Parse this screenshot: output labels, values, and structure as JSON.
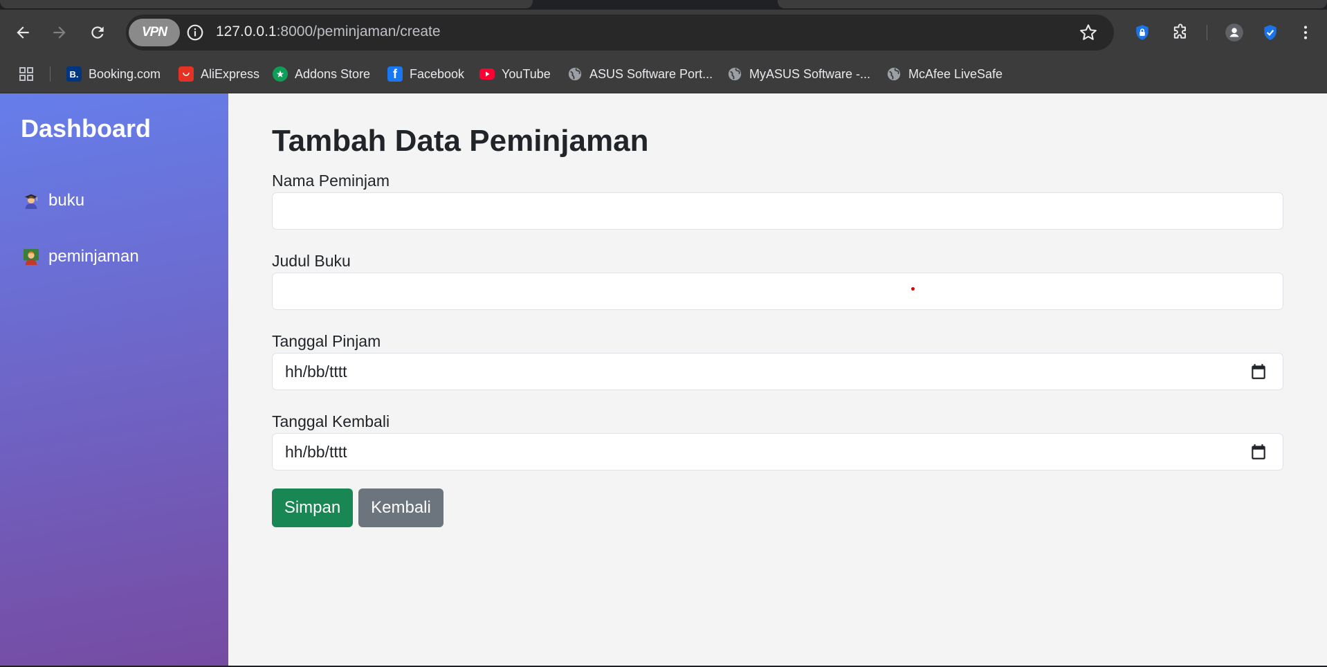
{
  "browser": {
    "url_host": "127.0.0.1",
    "url_path": ":8000/peminjaman/create",
    "vpn_label": "VPN",
    "bookmarks": [
      {
        "label": "Booking.com",
        "icon": "booking-icon",
        "color": "#003580",
        "glyph": "B."
      },
      {
        "label": "AliExpress",
        "icon": "aliexpress-icon",
        "color": "#e43225",
        "glyph": ""
      },
      {
        "label": "Addons Store",
        "icon": "addons-store-icon",
        "color": "#0f9d58",
        "glyph": ""
      },
      {
        "label": "Facebook",
        "icon": "facebook-icon",
        "color": "#1877f2",
        "glyph": "f"
      },
      {
        "label": "YouTube",
        "icon": "youtube-icon",
        "color": "#ff0033",
        "glyph": ""
      },
      {
        "label": "ASUS Software Port...",
        "icon": "globe-icon",
        "color": "#9aa0a6",
        "glyph": ""
      },
      {
        "label": "MyASUS Software -...",
        "icon": "globe-icon",
        "color": "#9aa0a6",
        "glyph": ""
      },
      {
        "label": "McAfee LiveSafe",
        "icon": "globe-icon",
        "color": "#9aa0a6",
        "glyph": ""
      }
    ]
  },
  "sidebar": {
    "brand": "Dashboard",
    "items": [
      {
        "label": "buku",
        "icon": "student-emoji-icon"
      },
      {
        "label": "peminjaman",
        "icon": "teacher-emoji-icon"
      }
    ]
  },
  "form": {
    "title": "Tambah Data Peminjaman",
    "fields": [
      {
        "label": "Nama Peminjam",
        "value": "",
        "type": "text"
      },
      {
        "label": "Judul Buku",
        "value": "",
        "type": "text"
      },
      {
        "label": "Tanggal Pinjam",
        "value": "hh/bb/tttt",
        "type": "date"
      },
      {
        "label": "Tanggal Kembali",
        "value": "hh/bb/tttt",
        "type": "date"
      }
    ],
    "save_label": "Simpan",
    "back_label": "Kembali"
  },
  "colors": {
    "sidebar_gradient_start": "#667eea",
    "sidebar_gradient_end": "#764ba2",
    "save_button": "#198754",
    "back_button": "#6c757d"
  }
}
